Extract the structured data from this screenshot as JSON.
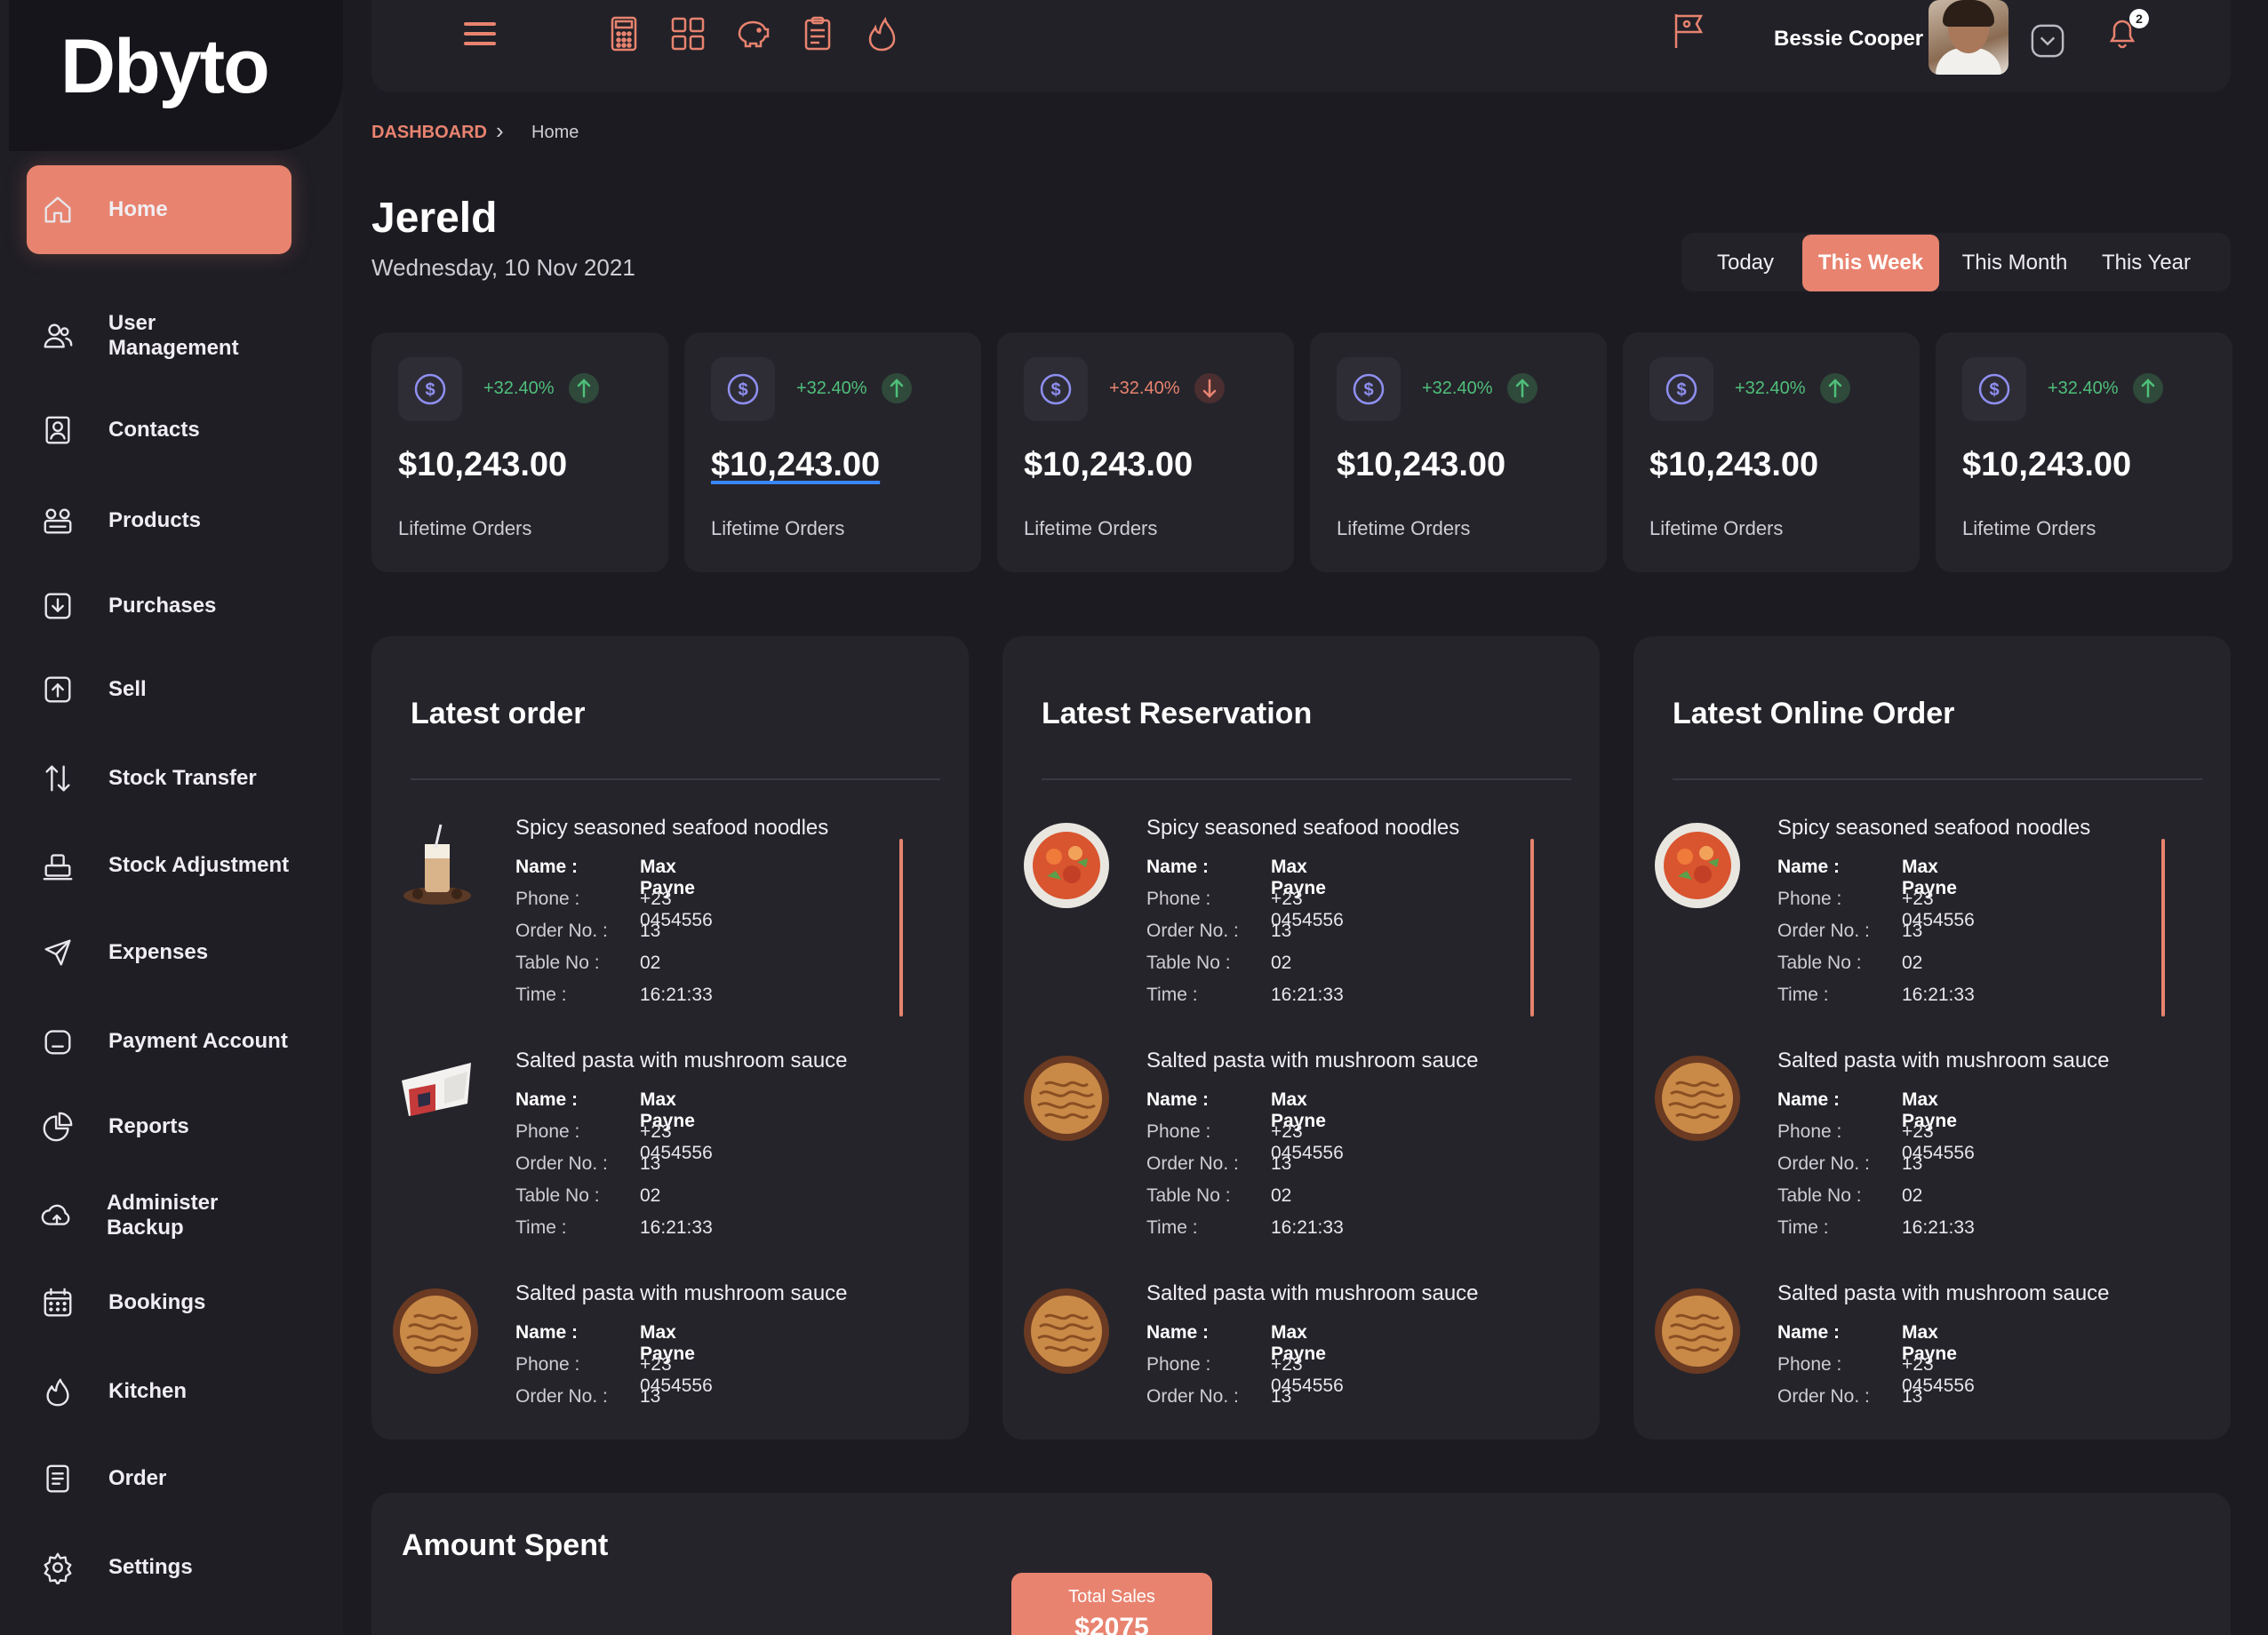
{
  "brand": {
    "logo_text": "byto",
    "logo_mark": "D"
  },
  "sidebar": {
    "items": [
      {
        "label": "Home",
        "icon": "home-icon",
        "active": true
      },
      {
        "label": "User Management",
        "icon": "users-icon"
      },
      {
        "label": "Contacts",
        "icon": "contact-card-icon"
      },
      {
        "label": "Products",
        "icon": "products-icon"
      },
      {
        "label": "Purchases",
        "icon": "download-box-icon"
      },
      {
        "label": "Sell",
        "icon": "upload-box-icon"
      },
      {
        "label": "Stock Transfer",
        "icon": "swap-arrows-icon"
      },
      {
        "label": "Stock Adjustment",
        "icon": "stock-adjust-icon"
      },
      {
        "label": "Expenses",
        "icon": "send-icon"
      },
      {
        "label": "Payment Account",
        "icon": "wallet-icon"
      },
      {
        "label": "Reports",
        "icon": "pie-chart-icon"
      },
      {
        "label": "Administer Backup",
        "icon": "cloud-upload-icon"
      },
      {
        "label": "Bookings",
        "icon": "calendar-icon"
      },
      {
        "label": "Kitchen",
        "icon": "flame-icon"
      },
      {
        "label": "Order",
        "icon": "receipt-icon"
      },
      {
        "label": "Settings",
        "icon": "gear-icon"
      }
    ]
  },
  "topbar": {
    "icons": [
      "menu-icon",
      "calculator-icon",
      "grid-icon",
      "piggy-bank-icon",
      "clipboard-icon",
      "flame-icon"
    ],
    "user_name": "Bessie Cooper",
    "notification_count": "2"
  },
  "breadcrumb": {
    "root": "DASHBOARD",
    "current": "Home"
  },
  "page": {
    "title": "Jereld",
    "date": "Wednesday, 10 Nov 2021"
  },
  "range": {
    "options": [
      "Today",
      "This Week",
      "This Month",
      "This Year"
    ],
    "selected": "This Week"
  },
  "stats": [
    {
      "pct": "+32.40%",
      "trend": "up",
      "value": "$10,243.00",
      "label": "Lifetime Orders"
    },
    {
      "pct": "+32.40%",
      "trend": "up",
      "value": "$10,243.00",
      "label": "Lifetime Orders"
    },
    {
      "pct": "+32.40%",
      "trend": "down",
      "value": "$10,243.00",
      "label": "Lifetime Orders"
    },
    {
      "pct": "+32.40%",
      "trend": "up",
      "value": "$10,243.00",
      "label": "Lifetime Orders"
    },
    {
      "pct": "+32.40%",
      "trend": "up",
      "value": "$10,243.00",
      "label": "Lifetime Orders"
    },
    {
      "pct": "+32.40%",
      "trend": "up",
      "value": "$10,243.00",
      "label": "Lifetime Orders"
    }
  ],
  "field_labels": {
    "name": "Name :",
    "phone": "Phone :",
    "order_no": "Order No. :",
    "table_no": "Table No :",
    "time": "Time :"
  },
  "panels": [
    {
      "title": "Latest order",
      "items": [
        {
          "title": "Spicy seasoned seafood noodles",
          "name": "Max Payne",
          "phone": "+23 0454556",
          "order_no": "13",
          "table_no": "02",
          "time": "16:21:33",
          "thumb": "drink"
        },
        {
          "title": "Salted pasta with mushroom sauce",
          "name": "Max Payne",
          "phone": "+23 0454556",
          "order_no": "13",
          "table_no": "02",
          "time": "16:21:33",
          "thumb": "box"
        },
        {
          "title": "Salted pasta with mushroom sauce",
          "name": "Max Payne",
          "phone": "+23 0454556",
          "order_no": "13",
          "thumb": "pasta"
        }
      ]
    },
    {
      "title": "Latest Reservation",
      "items": [
        {
          "title": "Spicy seasoned seafood noodles",
          "name": "Max Payne",
          "phone": "+23 0454556",
          "order_no": "13",
          "table_no": "02",
          "time": "16:21:33",
          "thumb": "salad"
        },
        {
          "title": "Salted pasta with mushroom sauce",
          "name": "Max Payne",
          "phone": "+23 0454556",
          "order_no": "13",
          "table_no": "02",
          "time": "16:21:33",
          "thumb": "pasta"
        },
        {
          "title": "Salted pasta with mushroom sauce",
          "name": "Max Payne",
          "phone": "+23 0454556",
          "order_no": "13",
          "thumb": "pasta"
        }
      ]
    },
    {
      "title": "Latest Online Order",
      "items": [
        {
          "title": "Spicy seasoned seafood noodles",
          "name": "Max Payne",
          "phone": "+23 0454556",
          "order_no": "13",
          "table_no": "02",
          "time": "16:21:33",
          "thumb": "salad"
        },
        {
          "title": "Salted pasta with mushroom sauce",
          "name": "Max Payne",
          "phone": "+23 0454556",
          "order_no": "13",
          "table_no": "02",
          "time": "16:21:33",
          "thumb": "pasta"
        },
        {
          "title": "Salted pasta with mushroom sauce",
          "name": "Max Payne",
          "phone": "+23 0454556",
          "order_no": "13",
          "thumb": "pasta"
        }
      ]
    }
  ],
  "amount_spent": {
    "title": "Amount Spent",
    "tooltip_label": "Total Sales",
    "tooltip_value": "$2075"
  },
  "colors": {
    "accent": "#e8836f",
    "background": "#1c1b22",
    "card": "#25242b",
    "up": "#4fbf7a",
    "link": "#3a86ff"
  }
}
